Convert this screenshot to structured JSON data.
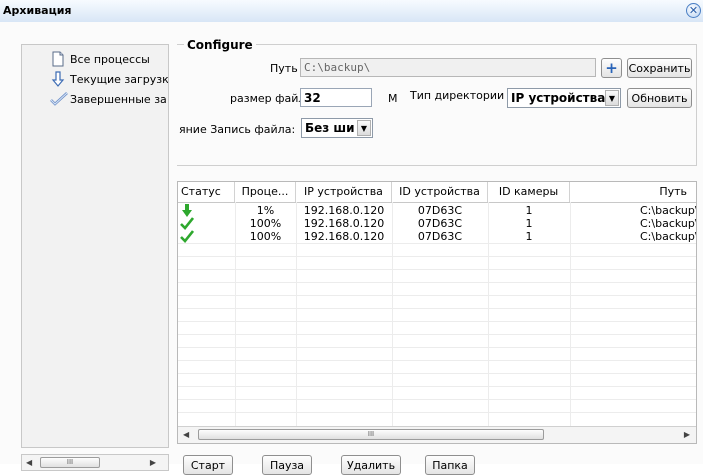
{
  "window": {
    "title": "Архивация"
  },
  "nav": {
    "items": [
      {
        "label": "Все процессы",
        "icon": "document-icon"
      },
      {
        "label": "Текущие загрузк",
        "icon": "download-arrow-icon"
      },
      {
        "label": "Завершенные за",
        "icon": "checkmark-icon"
      }
    ]
  },
  "configure": {
    "legend": "Configure",
    "path_label": "Путь",
    "path_value": "C:\\backup\\",
    "save_button": "Сохранить",
    "filesize_label": "размер файл",
    "filesize_value": "32",
    "filesize_unit": "M",
    "dirtype_label": "Тип директории",
    "dirtype_value": "IP устройства",
    "refresh_button": "Обновить",
    "overwrite_label": "яние Запись файла:",
    "overwrite_value": "Без ши"
  },
  "table": {
    "columns": [
      "Статус",
      "Проце...",
      "IP устройства",
      "ID устройства",
      "ID камеры",
      "Путь"
    ],
    "rows": [
      {
        "status": "downloading",
        "progress": "1%",
        "ip": "192.168.0.120",
        "device_id": "07D63C",
        "camera_id": "1",
        "path": "C:\\backup\\"
      },
      {
        "status": "done",
        "progress": "100%",
        "ip": "192.168.0.120",
        "device_id": "07D63C",
        "camera_id": "1",
        "path": "C:\\backup\\"
      },
      {
        "status": "done",
        "progress": "100%",
        "ip": "192.168.0.120",
        "device_id": "07D63C",
        "camera_id": "1",
        "path": "C:\\backup\\"
      }
    ],
    "scroll_thumb": "III"
  },
  "actions": {
    "start": "Старт",
    "pause": "Пауза",
    "delete": "Удалить",
    "folder": "Папка"
  },
  "nav_scroll": {
    "thumb": "III"
  },
  "colors": {
    "accent": "#2a64b8",
    "status_green": "#2ea82e"
  }
}
